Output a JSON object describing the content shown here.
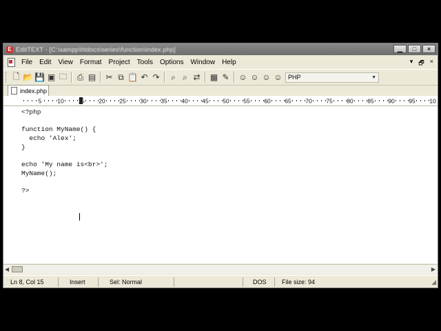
{
  "window": {
    "title": "EditTEXT - [C:\\xampp\\htdocs\\series\\function\\index.php]",
    "controls": {
      "minimize": "▁",
      "maximize": "□",
      "close": "×"
    }
  },
  "menu": {
    "items": [
      "File",
      "Edit",
      "View",
      "Format",
      "Project",
      "Tools",
      "Options",
      "Window",
      "Help"
    ],
    "mdi_controls": [
      "▾",
      "🗗",
      "×"
    ]
  },
  "toolbar": {
    "icons": [
      "new-file-icon",
      "open-icon",
      "save-icon",
      "save-all-icon",
      "folder-icon",
      "print-icon",
      "print-preview-icon",
      "cut-icon",
      "copy-icon",
      "paste-icon",
      "undo-icon",
      "redo-icon",
      "find-icon",
      "find-next-icon",
      "replace-icon",
      "word-wrap-icon",
      "settings-icon",
      "user-icon-1",
      "user-icon-2",
      "user-icon-3",
      "user-icon-4"
    ],
    "syntax_value": "PHP"
  },
  "tabs": [
    {
      "label": "index.php"
    }
  ],
  "ruler": {
    "labels": [
      "5",
      "10",
      "15",
      "20",
      "25",
      "30",
      "35",
      "40",
      "45",
      "50",
      "55",
      "60",
      "65",
      "70",
      "75",
      "80",
      "85",
      "90",
      "95",
      "10"
    ],
    "marker_column": 15
  },
  "editor": {
    "lines": [
      "<?php",
      "",
      "function MyName() {",
      "  echo 'Alex';",
      "}",
      "",
      "echo 'My name is<br>';",
      "MyName();",
      "",
      "?>"
    ]
  },
  "status": {
    "position": "Ln 8, Col 15",
    "mode": "Insert",
    "selection": "Sel: Normal",
    "empty": "",
    "line_ending": "DOS",
    "file_size": "File size: 94"
  },
  "colors": {
    "background": "#000000",
    "window_face": "#ece9d8",
    "titlebar": "#7a7a7a",
    "editor": "#ffffff",
    "app_icon": "#cc3333"
  }
}
